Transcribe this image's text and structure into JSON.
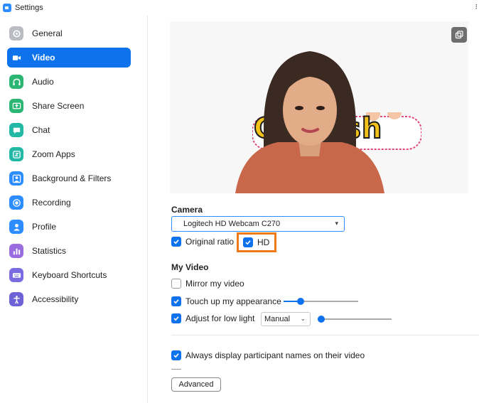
{
  "window": {
    "title": "Settings"
  },
  "sidebar": {
    "items": [
      {
        "label": "General",
        "icon": "gear-icon",
        "color": "#b9bcc2",
        "active": false
      },
      {
        "label": "Video",
        "icon": "video-camera-icon",
        "color": "#ffffff",
        "active": true
      },
      {
        "label": "Audio",
        "icon": "headphones-icon",
        "color": "#2bb673",
        "active": false
      },
      {
        "label": "Share Screen",
        "icon": "share-screen-icon",
        "color": "#2bb673",
        "active": false
      },
      {
        "label": "Chat",
        "icon": "chat-icon",
        "color": "#21b8a6",
        "active": false
      },
      {
        "label": "Zoom Apps",
        "icon": "zoom-apps-icon",
        "color": "#21b8a6",
        "active": false
      },
      {
        "label": "Background & Filters",
        "icon": "person-background-icon",
        "color": "#2d8cff",
        "active": false
      },
      {
        "label": "Recording",
        "icon": "record-icon",
        "color": "#2d8cff",
        "active": false
      },
      {
        "label": "Profile",
        "icon": "profile-icon",
        "color": "#2d8cff",
        "active": false
      },
      {
        "label": "Statistics",
        "icon": "bar-chart-icon",
        "color": "#9a6ce0",
        "active": false
      },
      {
        "label": "Keyboard Shortcuts",
        "icon": "keyboard-icon",
        "color": "#7a6ce0",
        "active": false
      },
      {
        "label": "Accessibility",
        "icon": "accessibility-icon",
        "color": "#6e63d6",
        "active": false
      }
    ],
    "accent": "#0e72ed"
  },
  "main": {
    "preview": {
      "sticker_text": "Gr... ish",
      "pip_icon": "picture-in-picture-icon"
    },
    "camera": {
      "section_title": "Camera",
      "selected": "Logitech HD Webcam C270",
      "original_ratio_label": "Original ratio",
      "original_ratio_checked": true,
      "hd_label": "HD",
      "hd_checked": true,
      "highlight_color": "#ef7a1a"
    },
    "my_video": {
      "section_title": "My Video",
      "mirror_label": "Mirror my video",
      "mirror_checked": false,
      "touch_up_label": "Touch up my appearance",
      "touch_up_checked": true,
      "touch_up_level": 0.2,
      "low_light_label": "Adjust for low light",
      "low_light_checked": true,
      "low_light_mode": "Manual",
      "low_light_level": 0.0
    },
    "participants": {
      "always_display_label": "Always display participant names on their video",
      "always_display_checked": true
    },
    "advanced_label": "Advanced"
  }
}
